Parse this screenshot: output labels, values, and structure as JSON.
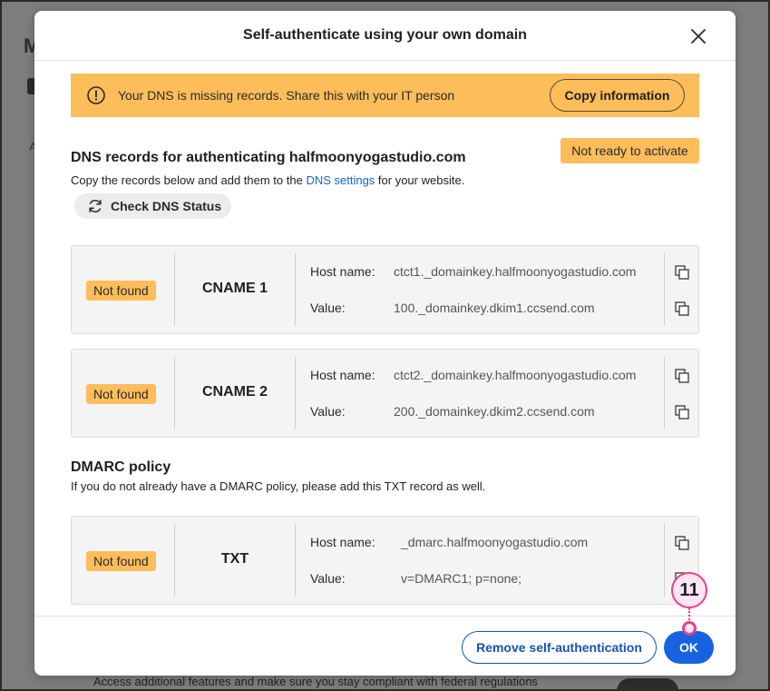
{
  "background": {
    "title_initial": "M",
    "letter_a": "A",
    "bottom_text": "Access additional features and make sure you stay compliant with federal regulations"
  },
  "modal": {
    "title": "Self-authenticate using your own domain",
    "alert": {
      "text": "Your DNS is missing records. Share this with your IT person",
      "button": "Copy information"
    },
    "dns_section": {
      "title": "DNS records for authenticating halfmoonyogastudio.com",
      "status_badge": "Not ready to activate",
      "sub_before": "Copy the records below and add them to the ",
      "sub_link": "DNS settings",
      "sub_after": " for your website.",
      "check_button": "Check DNS Status"
    },
    "records": [
      {
        "status": "Not found",
        "type": "CNAME 1",
        "host_label": "Host name:",
        "host_value": "ctct1._domainkey.halfmoonyogastudio.com",
        "value_label": "Value:",
        "value_value": "100._domainkey.dkim1.ccsend.com"
      },
      {
        "status": "Not found",
        "type": "CNAME 2",
        "host_label": "Host name:",
        "host_value": "ctct2._domainkey.halfmoonyogastudio.com",
        "value_label": "Value:",
        "value_value": "200._domainkey.dkim2.ccsend.com"
      },
      {
        "status": "Not found",
        "type": "TXT",
        "host_label": "Host name:",
        "host_value": "_dmarc.halfmoonyogastudio.com",
        "value_label": "Value:",
        "value_value": "v=DMARC1; p=none;"
      }
    ],
    "dmarc_section": {
      "title": "DMARC policy",
      "sub": "If you do not already have a DMARC policy, please add this TXT record as well."
    },
    "footer": {
      "remove_button": "Remove self-authentication",
      "ok_button": "OK"
    }
  },
  "step_marker": "11",
  "colors": {
    "warning": "#fdbd5b",
    "primary": "#1762e0",
    "link": "#1764c8",
    "marker": "#e6408a"
  },
  "icons": [
    "close-icon",
    "warning-icon",
    "refresh-icon",
    "copy-icon"
  ]
}
